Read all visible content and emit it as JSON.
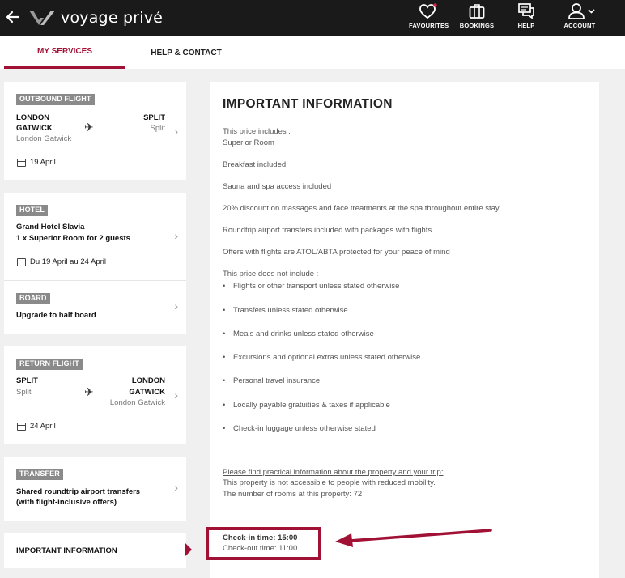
{
  "header": {
    "brand": "voyage privé",
    "nav": [
      {
        "label": "FAVOURITES",
        "icon": "heart-icon"
      },
      {
        "label": "BOOKINGS",
        "icon": "suitcase-icon"
      },
      {
        "label": "HELP",
        "icon": "chat-icon"
      },
      {
        "label": "ACCOUNT",
        "icon": "user-icon"
      }
    ]
  },
  "tabs": {
    "services": "MY SERVICES",
    "help": "HELP & CONTACT"
  },
  "outbound": {
    "badge": "OUTBOUND FLIGHT",
    "from_code": "LONDON",
    "from_code2": "GATWICK",
    "from_name": "London Gatwick",
    "to_code": "SPLIT",
    "to_name": "Split",
    "date": "19 April"
  },
  "hotel": {
    "badge": "HOTEL",
    "name": "Grand Hotel Slavia",
    "room": "1 x Superior Room for 2 guests",
    "dates": "Du 19 April au 24 April"
  },
  "board": {
    "badge": "BOARD",
    "value": "Upgrade to half board"
  },
  "return": {
    "badge": "RETURN FLIGHT",
    "from_code": "SPLIT",
    "from_name": "Split",
    "to_code": "LONDON",
    "to_code2": "GATWICK",
    "to_name": "London Gatwick",
    "date": "24 April"
  },
  "transfer": {
    "badge": "TRANSFER",
    "line1": "Shared roundtrip airport transfers",
    "line2": "(with flight-inclusive offers)"
  },
  "important_nav": "IMPORTANT INFORMATION",
  "info": {
    "title": "IMPORTANT INFORMATION",
    "includes_label": "This price includes :",
    "includes": [
      "Superior Room",
      "Breakfast included",
      "Sauna and spa access included",
      "20% discount on massages and face treatments at the spa throughout entire stay",
      "Roundtrip airport transfers included with packages with flights",
      "Offers with flights are ATOL/ABTA protected for your peace of mind"
    ],
    "excludes_label": "This price does not include :",
    "excludes": [
      "Flights or other transport unless stated otherwise",
      "Transfers unless stated otherwise",
      "Meals and drinks unless stated otherwise",
      "Excursions and optional extras unless stated otherwise",
      "Personal travel insurance",
      "Locally payable gratuities & taxes if applicable",
      "Check-in luggage unless otherwise stated"
    ],
    "practical_heading": "Please find practical information about the property and your trip:",
    "mobility": "This property is not accessible to people with reduced mobility.",
    "rooms": "The number of rooms at this property: 72",
    "checkin": "Check-in time: 15:00",
    "checkout": "Check-out time: 11:00"
  },
  "colors": {
    "accent": "#a11035",
    "topbar": "#1a1a1a",
    "badge": "#8a8a8a"
  }
}
